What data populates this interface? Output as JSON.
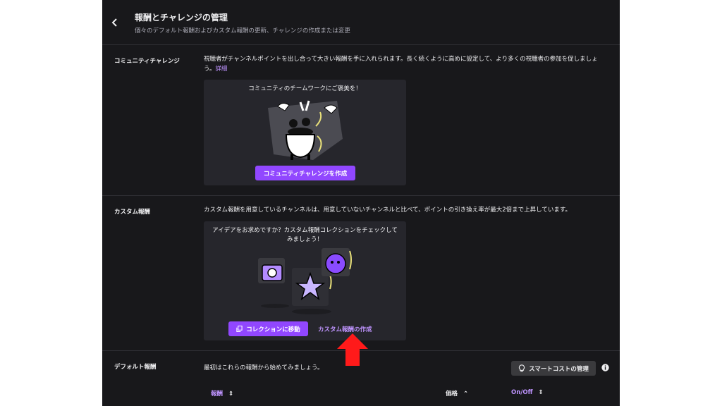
{
  "header": {
    "back_icon": "chevron-left-icon",
    "title": "報酬とチャレンジの管理",
    "subtitle": "個々のデフォルト報酬およびカスタム報酬の更新、チャレンジの作成または変更"
  },
  "community": {
    "label": "コミュニティチャレンジ",
    "description": "視聴者がチャンネルポイントを出し合って大きい報酬を手に入れられます。長く続くように高めに設定して、より多くの視聴者の参加を促しましょう。",
    "details_link": "詳細",
    "card_title": "コミュニティのチームワークにご褒美を！",
    "create_button": "コミュニティチャレンジを作成"
  },
  "custom": {
    "label": "カスタム報酬",
    "description": "カスタム報酬を用意しているチャンネルは、用意していないチャンネルと比べて、ポイントの引き換え率が最大2倍まで上昇しています。",
    "card_title_line1": "アイデアをお求めですか？カスタム報酬コレクションをチェックして",
    "card_title_line2": "みましょう！",
    "collection_button": "コレクションに移動",
    "create_link": "カスタム報酬の作成"
  },
  "default": {
    "label": "デフォルト報酬",
    "description": "最初はこれらの報酬から始めてみましょう。",
    "smart_cost_button": "スマートコストの管理",
    "columns": {
      "reward": "報酬",
      "price": "価格",
      "onoff": "On/Off"
    }
  },
  "colors": {
    "panel_bg": "#18181b",
    "card_bg": "#26262c",
    "accent": "#9147ff",
    "link": "#bf94ff",
    "annotation_arrow": "#ff1a1a"
  }
}
